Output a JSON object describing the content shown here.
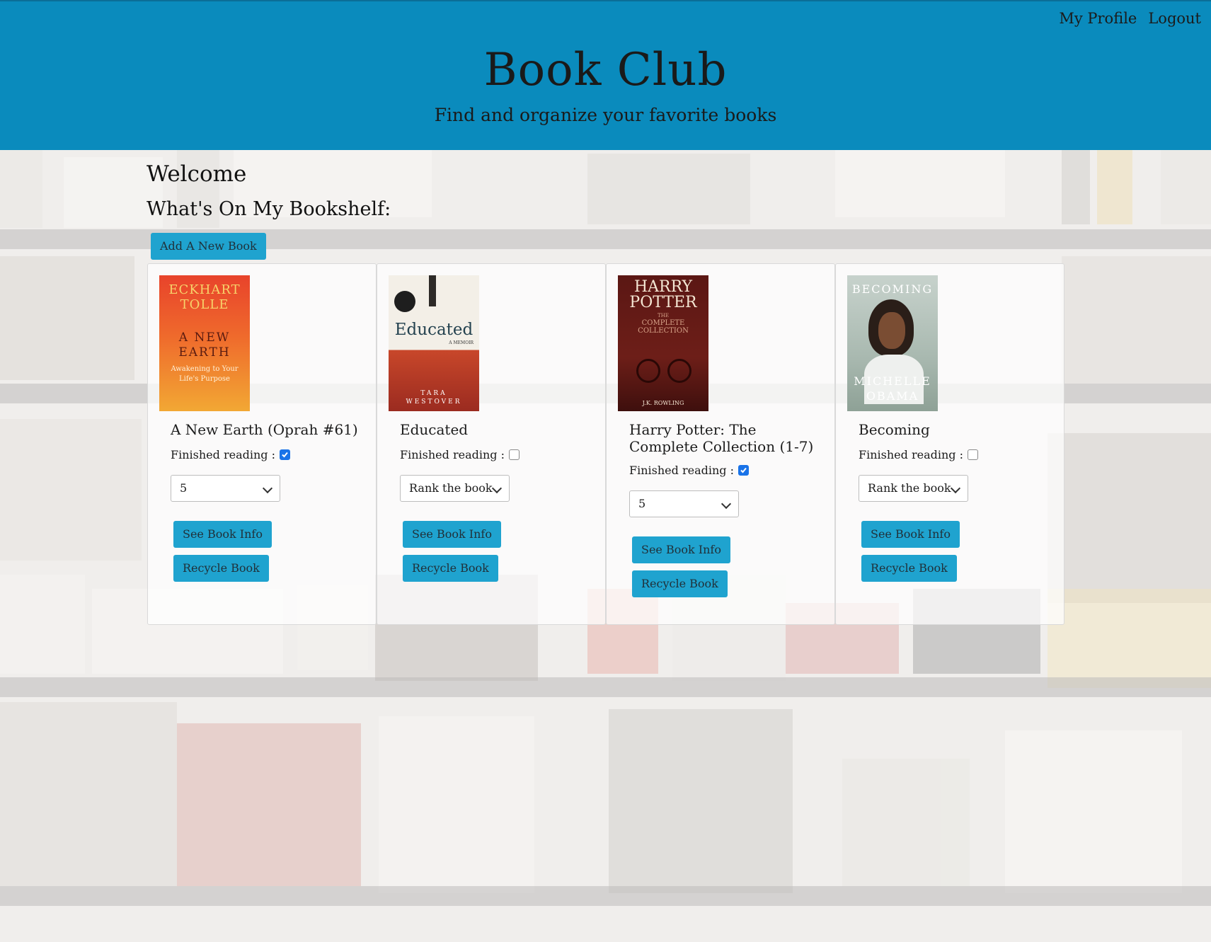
{
  "header": {
    "title": "Book Club",
    "subtitle": "Find and organize your favorite books",
    "nav": {
      "profile": "My Profile",
      "logout": "Logout"
    },
    "background_color": "#0a8bbd"
  },
  "main": {
    "welcome": "Welcome",
    "shelf_heading": "What's On My Bookshelf:",
    "add_book_label": "Add A New Book"
  },
  "books": [
    {
      "title": "A New Earth (Oprah #61)",
      "finished_label": "Finished reading :",
      "finished": true,
      "rank": "5",
      "info_label": "See Book Info",
      "recycle_label": "Recycle Book",
      "cover": {
        "lines": [
          "ECKHART",
          "TOLLE",
          "A NEW",
          "EARTH",
          "Awakening to Your",
          "Life's Purpose"
        ]
      }
    },
    {
      "title": "Educated",
      "finished_label": "Finished reading :",
      "finished": false,
      "rank": "Rank the book",
      "info_label": "See Book Info",
      "recycle_label": "Recycle Book",
      "cover": {
        "lines": [
          "Educated",
          "A MEMOIR",
          "TARA",
          "WESTOVER"
        ]
      }
    },
    {
      "title": "Harry Potter: The Complete Collection (1-7)",
      "finished_label": "Finished reading :",
      "finished": true,
      "rank": "5",
      "info_label": "See Book Info",
      "recycle_label": "Recycle Book",
      "cover": {
        "lines": [
          "HARRY",
          "POTTER",
          "THE",
          "COMPLETE",
          "COLLECTION",
          "J.K. ROWLING"
        ]
      }
    },
    {
      "title": "Becoming",
      "finished_label": "Finished reading :",
      "finished": false,
      "rank": "Rank the book",
      "info_label": "See Book Info",
      "recycle_label": "Recycle Book",
      "cover": {
        "lines": [
          "BECOMING",
          "MICHELLE",
          "OBAMA"
        ]
      }
    }
  ],
  "colors": {
    "accent_button": "#1fa3cf",
    "checkbox_checked": "#1a73e8"
  }
}
